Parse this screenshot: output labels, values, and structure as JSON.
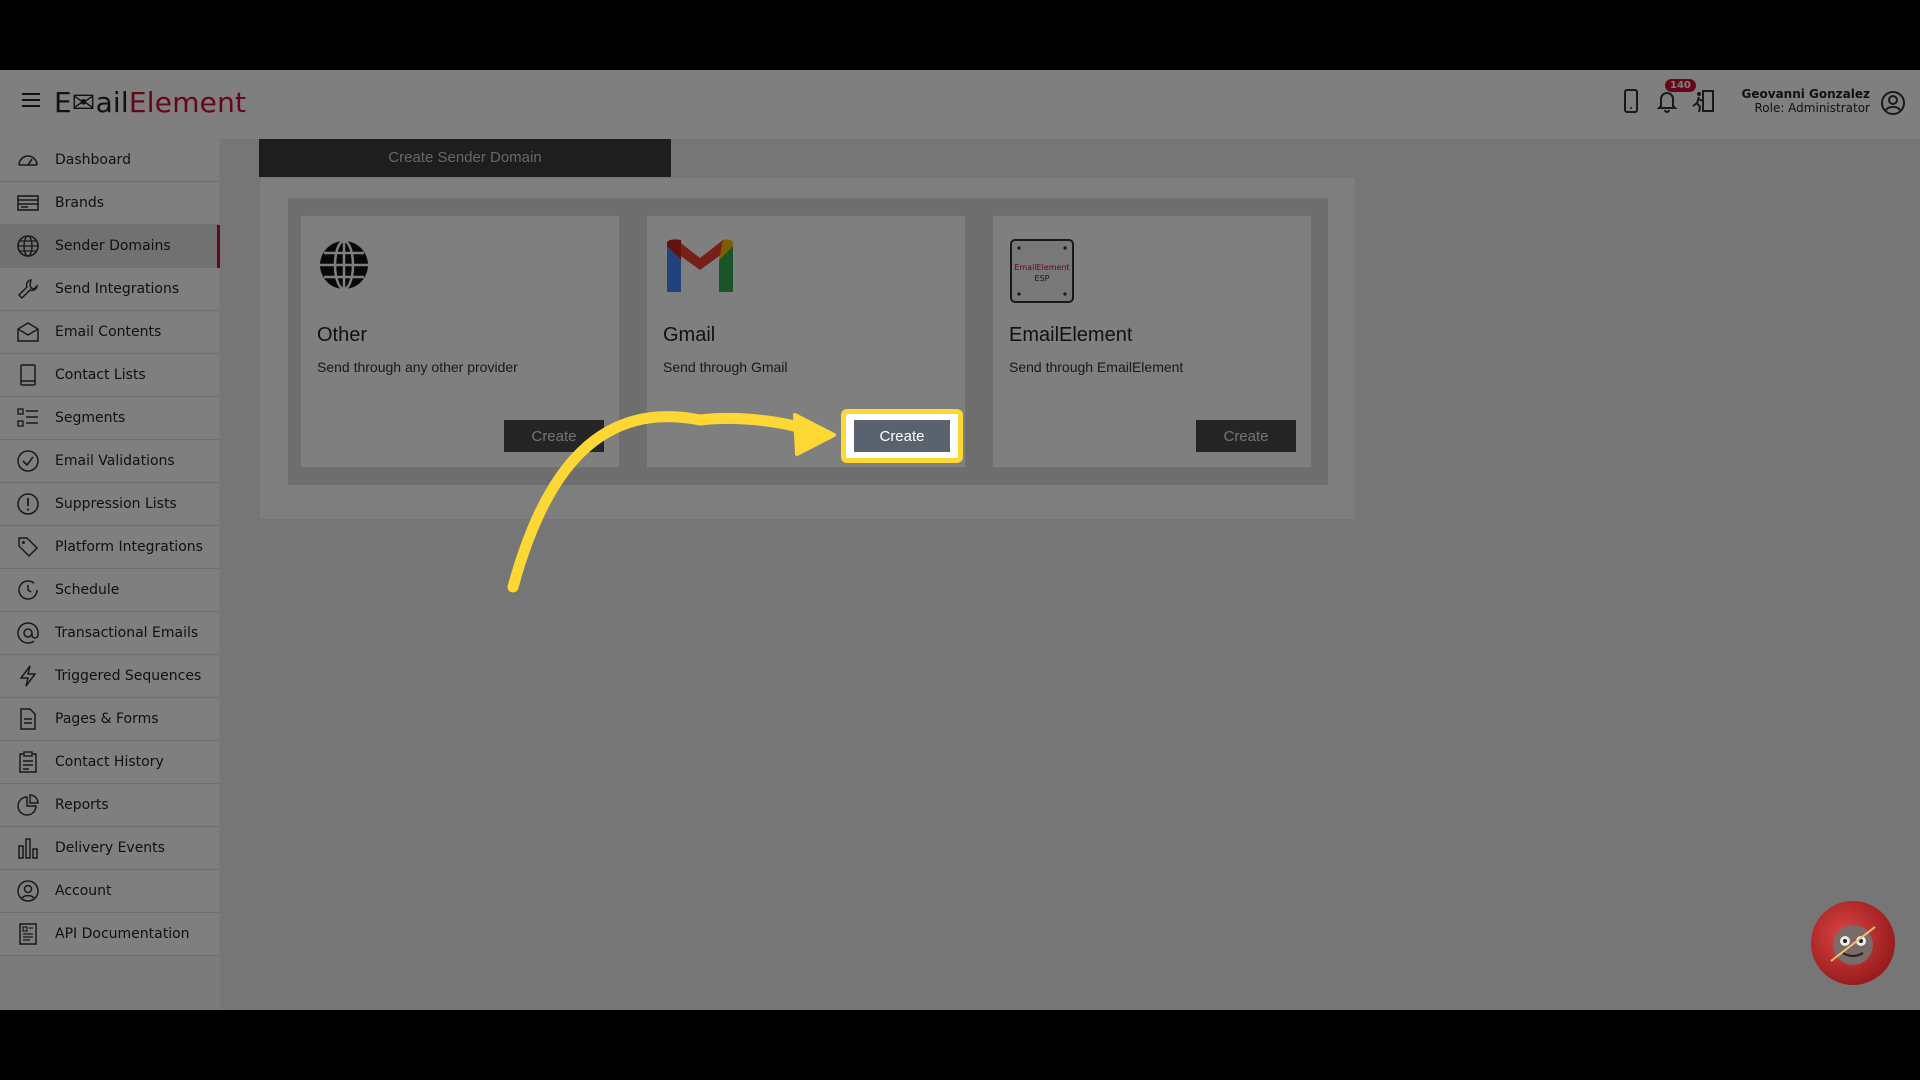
{
  "app": {
    "logo_prefix": "E",
    "logo_mid": "ail",
    "logo_suffix": "Element"
  },
  "header": {
    "notification_count": "140",
    "user_name": "Geovanni Gonzalez",
    "user_role": "Role: Administrator"
  },
  "sidebar": {
    "items": [
      {
        "label": "Dashboard",
        "icon": "dashboard-icon"
      },
      {
        "label": "Brands",
        "icon": "brands-icon"
      },
      {
        "label": "Sender Domains",
        "icon": "globe-icon",
        "active": true
      },
      {
        "label": "Send Integrations",
        "icon": "wrench-icon"
      },
      {
        "label": "Email Contents",
        "icon": "envelope-icon"
      },
      {
        "label": "Contact Lists",
        "icon": "book-icon"
      },
      {
        "label": "Segments",
        "icon": "segments-icon"
      },
      {
        "label": "Email Validations",
        "icon": "check-circle-icon"
      },
      {
        "label": "Suppression Lists",
        "icon": "exclamation-circle-icon"
      },
      {
        "label": "Platform Integrations",
        "icon": "tag-icon"
      },
      {
        "label": "Schedule",
        "icon": "clock-icon"
      },
      {
        "label": "Transactional Emails",
        "icon": "at-icon"
      },
      {
        "label": "Triggered Sequences",
        "icon": "lightning-icon"
      },
      {
        "label": "Pages & Forms",
        "icon": "file-icon"
      },
      {
        "label": "Contact History",
        "icon": "clipboard-icon"
      },
      {
        "label": "Reports",
        "icon": "pie-chart-icon"
      },
      {
        "label": "Delivery Events",
        "icon": "bar-chart-icon"
      },
      {
        "label": "Account",
        "icon": "user-circle-icon"
      },
      {
        "label": "API Documentation",
        "icon": "document-icon"
      }
    ]
  },
  "main": {
    "tab_title": "Create Sender Domain",
    "cards": [
      {
        "title": "Other",
        "description": "Send through any other provider",
        "button": "Create",
        "icon": "globe-icon"
      },
      {
        "title": "Gmail",
        "description": "Send through Gmail",
        "button": "Create",
        "icon": "gmail-icon"
      },
      {
        "title": "EmailElement",
        "description": "Send through EmailElement",
        "button": "Create",
        "icon": "emailelement-esp-icon",
        "icon_text_1": "EmailElement",
        "icon_text_2": "ESP"
      }
    ]
  },
  "colors": {
    "brand_red": "#c8102e",
    "highlight_yellow": "#fdd835"
  }
}
